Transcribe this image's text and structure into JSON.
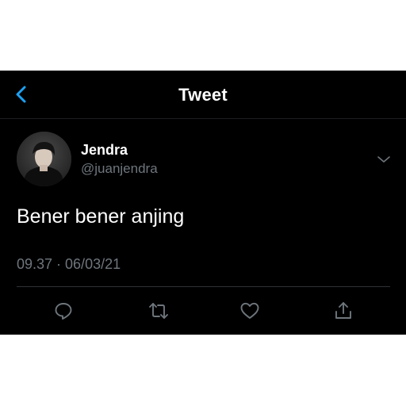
{
  "header": {
    "title": "Tweet",
    "back_icon": "chevron-left-icon"
  },
  "tweet": {
    "display_name": "Jendra",
    "handle": "@juanjendra",
    "text": "Bener bener anjing",
    "timestamp": "09.37 · 06/03/21",
    "more_icon": "chevron-down-icon"
  },
  "actions": [
    {
      "name": "reply",
      "icon": "comment-icon"
    },
    {
      "name": "retweet",
      "icon": "retweet-icon"
    },
    {
      "name": "like",
      "icon": "heart-icon"
    },
    {
      "name": "share",
      "icon": "share-icon"
    }
  ],
  "colors": {
    "background": "#000000",
    "accent": "#1da1f2",
    "secondary_text": "#6e767d",
    "divider": "#2f3336"
  }
}
